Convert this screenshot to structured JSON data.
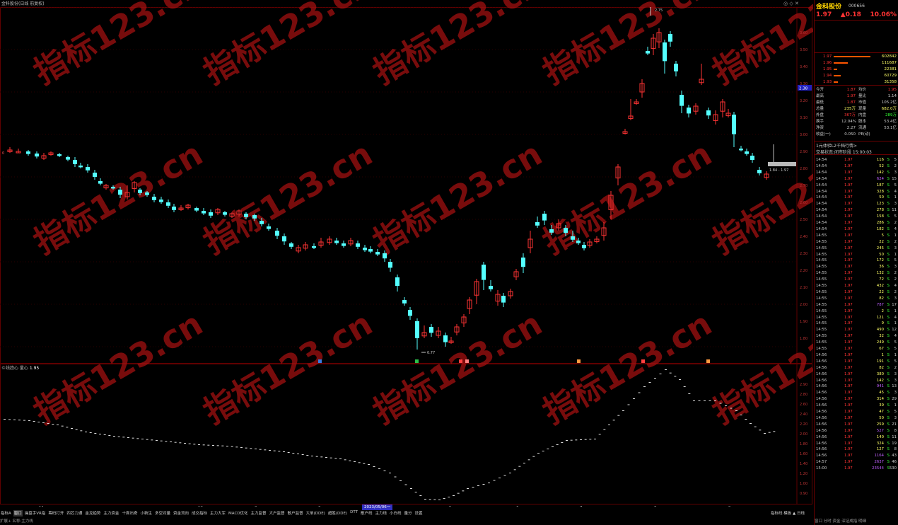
{
  "window": {
    "title": "金科股份(日线 前复权)",
    "controls": "◎ ◇ ✕"
  },
  "main_chart": {
    "price_labels": [
      "3.60",
      "3.50",
      "3.40",
      "3.30",
      "3.20",
      "3.10",
      "3.00",
      "2.90",
      "2.80",
      "2.70",
      "2.60",
      "2.50",
      "2.40",
      "2.30",
      "2.20",
      "2.10",
      "2.00",
      "1.90",
      "1.80"
    ],
    "current_price_tag": "2.38",
    "high_marker": "2.75",
    "low_marker": "0.77",
    "range_label": "1.84 - 1.97",
    "left_marker": "0"
  },
  "sub_chart": {
    "title": "©线趋心 量心",
    "value": "1.95",
    "labels": [
      "2.90",
      "2.80",
      "2.60",
      "2.40",
      "2.20",
      "2.00",
      "1.80",
      "1.60",
      "1.40",
      "1.20",
      "1.00",
      "0.90"
    ]
  },
  "x_axis": {
    "months": [
      "11",
      "12",
      "2",
      "3",
      "4",
      "5",
      "6",
      "7",
      "8",
      "9"
    ],
    "date_tag": "2023/05/06一"
  },
  "bottom_tabs": [
    "指标A",
    "窗口",
    "操盘手VR指",
    "筹码打开",
    "四芯力通",
    "金龙趋势",
    "主力资金",
    "十面出奇",
    "小新生",
    "多空对量",
    "资金流向",
    "成交指标",
    "主力大军",
    "MACD优化",
    "主力监督",
    "大户监督",
    "散户监督",
    "大单(DDE)",
    "超胜(DDE)",
    "DTT",
    "散户线",
    "主力线",
    "小白线",
    "量分",
    "设置"
  ],
  "status_bar": "扩展+ 名称:主力线",
  "period_bar": "指标线  模板  ▲  日线",
  "stock": {
    "name": "金科股份",
    "code": "000656",
    "price": "1.97",
    "change": "▲0.18",
    "pct": "10.06%"
  },
  "order_book": [
    {
      "label": "",
      "price": "1.97",
      "vol": "602842",
      "w": 52
    },
    {
      "label": "",
      "price": "1.96",
      "vol": "111687",
      "w": 20
    },
    {
      "label": "",
      "price": "1.95",
      "vol": "22381",
      "w": 5
    },
    {
      "label": "",
      "price": "1.94",
      "vol": "60729",
      "w": 10
    },
    {
      "label": "",
      "price": "1.93",
      "vol": "31358",
      "w": 6
    }
  ],
  "stats": [
    {
      "a": "今开",
      "b": "1.87",
      "bc": "#ff3333",
      "c": "均价",
      "d": "1.95",
      "dc": "#ff3333"
    },
    {
      "a": "最高",
      "b": "1.97",
      "bc": "#ff3333",
      "c": "量比",
      "d": "1.14",
      "dc": "#ccc"
    },
    {
      "a": "最低",
      "b": "1.87",
      "bc": "#ff3333",
      "c": "市值",
      "d": "105.2亿",
      "dc": "#ccc"
    },
    {
      "a": "总量",
      "b": "235万",
      "bc": "#ffff66",
      "c": "现量",
      "d": "682.0万",
      "dc": "#ffff66"
    },
    {
      "a": "外盘",
      "b": "367万",
      "bc": "#ff3333",
      "c": "内盘",
      "d": "289万",
      "dc": "#33ff33"
    },
    {
      "a": "换手",
      "b": "12.04%",
      "bc": "#ccc",
      "c": "股本",
      "d": "53.4亿",
      "dc": "#ccc"
    },
    {
      "a": "净资",
      "b": "2.27",
      "bc": "#ccc",
      "c": "流通",
      "d": "53.1亿",
      "dc": "#ccc"
    },
    {
      "a": "收益(一)",
      "b": "0.050",
      "bc": "#ccc",
      "c": "PE(动)",
      "d": "",
      "dc": "#ccc"
    }
  ],
  "info_lines": [
    "1元体验L2千档行情>",
    "交易状态:闭市阶段 15:00:03"
  ],
  "trades": [
    [
      "14:54",
      "1.97",
      "116",
      "S",
      "5"
    ],
    [
      "14:54",
      "1.97",
      "52",
      "S",
      "2"
    ],
    [
      "14:54",
      "1.97",
      "142",
      "S",
      "3"
    ],
    [
      "14:54",
      "1.97",
      "624",
      "S",
      "15"
    ],
    [
      "14:54",
      "1.97",
      "187",
      "S",
      "5"
    ],
    [
      "14:54",
      "1.97",
      "328",
      "S",
      "4"
    ],
    [
      "14:54",
      "1.97",
      "50",
      "S",
      "1"
    ],
    [
      "14:54",
      "1.97",
      "123",
      "S",
      "3"
    ],
    [
      "14:54",
      "1.97",
      "278",
      "S",
      "11"
    ],
    [
      "14:54",
      "1.97",
      "158",
      "S",
      "5"
    ],
    [
      "14:54",
      "1.97",
      "286",
      "S",
      "2"
    ],
    [
      "14:54",
      "1.97",
      "182",
      "S",
      "4"
    ],
    [
      "14:55",
      "1.97",
      "5",
      "S",
      "1"
    ],
    [
      "14:55",
      "1.97",
      "22",
      "S",
      "2"
    ],
    [
      "14:55",
      "1.97",
      "245",
      "S",
      "3"
    ],
    [
      "14:55",
      "1.97",
      "50",
      "S",
      "1"
    ],
    [
      "14:55",
      "1.97",
      "172",
      "S",
      "5"
    ],
    [
      "14:55",
      "1.97",
      "36",
      "S",
      "3"
    ],
    [
      "14:55",
      "1.97",
      "132",
      "S",
      "2"
    ],
    [
      "14:55",
      "1.97",
      "72",
      "S",
      "2"
    ],
    [
      "14:55",
      "1.97",
      "432",
      "S",
      "4"
    ],
    [
      "14:55",
      "1.97",
      "22",
      "S",
      "2"
    ],
    [
      "14:55",
      "1.97",
      "82",
      "S",
      "3"
    ],
    [
      "14:55",
      "1.97",
      "787",
      "S",
      "17"
    ],
    [
      "14:55",
      "1.97",
      "2",
      "S",
      "1"
    ],
    [
      "14:55",
      "1.97",
      "121",
      "S",
      "4"
    ],
    [
      "14:55",
      "1.97",
      "9",
      "S",
      "1"
    ],
    [
      "14:55",
      "1.97",
      "490",
      "S",
      "12"
    ],
    [
      "14:55",
      "1.97",
      "32",
      "S",
      "4"
    ],
    [
      "14:55",
      "1.97",
      "249",
      "S",
      "5"
    ],
    [
      "14:55",
      "1.97",
      "67",
      "S",
      "5"
    ],
    [
      "14:56",
      "1.97",
      "1",
      "S",
      "1"
    ],
    [
      "14:56",
      "1.97",
      "191",
      "S",
      "5"
    ],
    [
      "14:56",
      "1.97",
      "82",
      "S",
      "2"
    ],
    [
      "14:56",
      "1.97",
      "380",
      "S",
      "3"
    ],
    [
      "14:56",
      "1.97",
      "142",
      "S",
      "3"
    ],
    [
      "14:56",
      "1.97",
      "941",
      "S",
      "13"
    ],
    [
      "14:56",
      "1.97",
      "45",
      "S",
      "3"
    ],
    [
      "14:56",
      "1.97",
      "314",
      "S",
      "29"
    ],
    [
      "14:56",
      "1.97",
      "39",
      "S",
      "1"
    ],
    [
      "14:56",
      "1.97",
      "47",
      "S",
      "5"
    ],
    [
      "14:56",
      "1.97",
      "50",
      "S",
      "3"
    ],
    [
      "14:56",
      "1.97",
      "259",
      "S",
      "21"
    ],
    [
      "14:56",
      "1.97",
      "527",
      "S",
      "8"
    ],
    [
      "14:56",
      "1.97",
      "140",
      "S",
      "11"
    ],
    [
      "14:56",
      "1.97",
      "324",
      "S",
      "19"
    ],
    [
      "14:56",
      "1.97",
      "127",
      "S",
      "8"
    ],
    [
      "14:56",
      "1.97",
      "1164",
      "S",
      "43"
    ],
    [
      "14:57",
      "1.97",
      "2637",
      "S",
      "46"
    ],
    [
      "15:00",
      "1.97",
      "23544",
      "S",
      "530"
    ]
  ],
  "panel_footer": "窗口 分时 资金 深证成指 明细",
  "watermark": "指标123.cn",
  "colors": {
    "up": "#ff3333",
    "down": "#54ffff",
    "grid": "#600000",
    "bg": "#000000",
    "accent": "#ffd400"
  }
}
